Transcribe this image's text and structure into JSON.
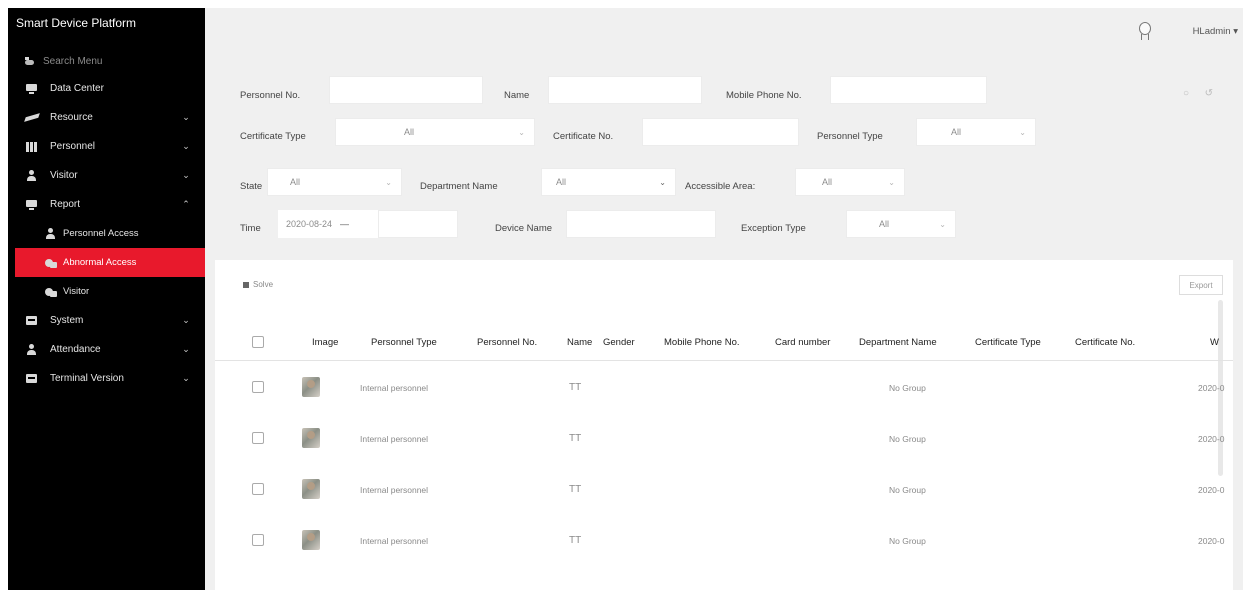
{
  "app": {
    "title": "Smart Device Platform"
  },
  "sidebar": {
    "search_placeholder": "Search Menu",
    "items": [
      {
        "label": "Data Center",
        "icon": "monitor-icon",
        "chevron": ""
      },
      {
        "label": "Resource",
        "icon": "plane-icon",
        "chevron": "⌄"
      },
      {
        "label": "Personnel",
        "icon": "bars-icon",
        "chevron": "⌄"
      },
      {
        "label": "Visitor",
        "icon": "person-icon",
        "chevron": "⌄"
      },
      {
        "label": "Report",
        "icon": "monitor-icon",
        "chevron": "⌃"
      }
    ],
    "sub_items": [
      {
        "label": "Personnel Access",
        "icon": "person-icon"
      },
      {
        "label": "Abnormal Access",
        "icon": "camera-icon",
        "active": true
      },
      {
        "label": "Visitor",
        "icon": "camera-icon"
      }
    ],
    "bottom_items": [
      {
        "label": "System",
        "icon": "box-icon",
        "chevron": "⌄"
      },
      {
        "label": "Attendance",
        "icon": "person-icon",
        "chevron": "⌄"
      },
      {
        "label": "Terminal Version",
        "icon": "box-icon",
        "chevron": "⌄"
      }
    ]
  },
  "header": {
    "user": "HLadmin ▾"
  },
  "filters": {
    "personnel_no_label": "Personnel No.",
    "name_label": "Name",
    "mobile_label": "Mobile Phone No.",
    "mobile_placeholder": "",
    "certificate_type_label": "Certificate Type",
    "certificate_type_value": "All",
    "certificate_no_label": "Certificate No.",
    "personnel_type_label": "Personnel Type",
    "personnel_type_value": "All",
    "state_label": "State",
    "state_value": "All",
    "department_label": "Department Name",
    "department_value": "All",
    "area_label": "Accessible Area:",
    "area_value": "All",
    "time_label": "Time",
    "time_start": "2020-08-24",
    "time_sep": "—",
    "device_label": "Device Name",
    "exception_label": "Exception Type",
    "exception_value": "All"
  },
  "toolbar": {
    "solve_label": "Solve",
    "export_label": "Export"
  },
  "table": {
    "columns": [
      "Image",
      "Personnel Type",
      "Personnel No.",
      "Name",
      "Gender",
      "Mobile Phone No.",
      "Card number",
      "Department Name",
      "Certificate Type",
      "Certificate No.",
      "W"
    ],
    "rows": [
      {
        "personnel_type": "Internal personnel",
        "name": "TT",
        "department": "No Group",
        "time": "2020-0"
      },
      {
        "personnel_type": "Internal personnel",
        "name": "TT",
        "department": "No Group",
        "time": "2020-0"
      },
      {
        "personnel_type": "Internal personnel",
        "name": "TT",
        "department": "No Group",
        "time": "2020-0"
      },
      {
        "personnel_type": "Internal personnel",
        "name": "TT",
        "department": "No Group",
        "time": "2020-0"
      }
    ]
  }
}
